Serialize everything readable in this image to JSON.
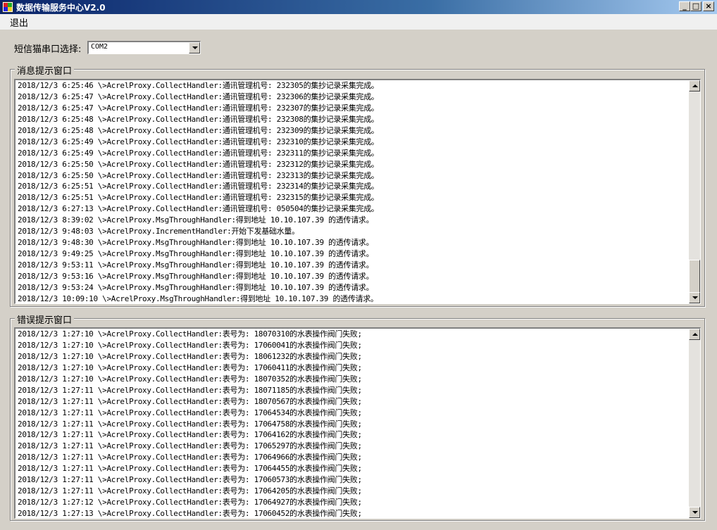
{
  "window": {
    "title": "数据传输服务中心V2.0",
    "buttons": {
      "minimize": "_",
      "maximize": "□",
      "close": "×"
    }
  },
  "menu": {
    "exit_label": "退出"
  },
  "com_select": {
    "label": "短信猫串口选择:",
    "value": "COM2"
  },
  "message_panel": {
    "title": "消息提示窗口",
    "lines": [
      "2018/12/3 6:25:46 \\>AcrelProxy.CollectHandler:通讯管理机号: 232305的集抄记录采集完成。",
      "2018/12/3 6:25:47 \\>AcrelProxy.CollectHandler:通讯管理机号: 232306的集抄记录采集完成。",
      "2018/12/3 6:25:47 \\>AcrelProxy.CollectHandler:通讯管理机号: 232307的集抄记录采集完成。",
      "2018/12/3 6:25:48 \\>AcrelProxy.CollectHandler:通讯管理机号: 232308的集抄记录采集完成。",
      "2018/12/3 6:25:48 \\>AcrelProxy.CollectHandler:通讯管理机号: 232309的集抄记录采集完成。",
      "2018/12/3 6:25:49 \\>AcrelProxy.CollectHandler:通讯管理机号: 232310的集抄记录采集完成。",
      "2018/12/3 6:25:49 \\>AcrelProxy.CollectHandler:通讯管理机号: 232311的集抄记录采集完成。",
      "2018/12/3 6:25:50 \\>AcrelProxy.CollectHandler:通讯管理机号: 232312的集抄记录采集完成。",
      "2018/12/3 6:25:50 \\>AcrelProxy.CollectHandler:通讯管理机号: 232313的集抄记录采集完成。",
      "2018/12/3 6:25:51 \\>AcrelProxy.CollectHandler:通讯管理机号: 232314的集抄记录采集完成。",
      "2018/12/3 6:25:51 \\>AcrelProxy.CollectHandler:通讯管理机号: 232315的集抄记录采集完成。",
      "2018/12/3 6:27:13 \\>AcrelProxy.CollectHandler:通讯管理机号: 050504的集抄记录采集完成。",
      "2018/12/3 8:39:02 \\>AcrelProxy.MsgThroughHandler:得到地址 10.10.107.39 的透传请求。",
      "2018/12/3 9:48:03 \\>AcrelProxy.IncrementHandler:开始下发基础水量。",
      "2018/12/3 9:48:30 \\>AcrelProxy.MsgThroughHandler:得到地址 10.10.107.39 的透传请求。",
      "2018/12/3 9:49:25 \\>AcrelProxy.MsgThroughHandler:得到地址 10.10.107.39 的透传请求。",
      "2018/12/3 9:53:11 \\>AcrelProxy.MsgThroughHandler:得到地址 10.10.107.39 的透传请求。",
      "2018/12/3 9:53:16 \\>AcrelProxy.MsgThroughHandler:得到地址 10.10.107.39 的透传请求。",
      "2018/12/3 9:53:24 \\>AcrelProxy.MsgThroughHandler:得到地址 10.10.107.39 的透传请求。",
      "2018/12/3 10:09:10 \\>AcrelProxy.MsgThroughHandler:得到地址 10.10.107.39 的透传请求。"
    ]
  },
  "error_panel": {
    "title": "错误提示窗口",
    "lines": [
      "2018/12/3 1:27:10 \\>AcrelProxy.CollectHandler:表号为: 18070310的水表操作阀门失败;",
      "2018/12/3 1:27:10 \\>AcrelProxy.CollectHandler:表号为: 17060041的水表操作阀门失败;",
      "2018/12/3 1:27:10 \\>AcrelProxy.CollectHandler:表号为: 18061232的水表操作阀门失败;",
      "2018/12/3 1:27:10 \\>AcrelProxy.CollectHandler:表号为: 17060411的水表操作阀门失败;",
      "2018/12/3 1:27:10 \\>AcrelProxy.CollectHandler:表号为: 18070352的水表操作阀门失败;",
      "2018/12/3 1:27:11 \\>AcrelProxy.CollectHandler:表号为: 18071185的水表操作阀门失败;",
      "2018/12/3 1:27:11 \\>AcrelProxy.CollectHandler:表号为: 18070567的水表操作阀门失败;",
      "2018/12/3 1:27:11 \\>AcrelProxy.CollectHandler:表号为: 17064534的水表操作阀门失败;",
      "2018/12/3 1:27:11 \\>AcrelProxy.CollectHandler:表号为: 17064758的水表操作阀门失败;",
      "2018/12/3 1:27:11 \\>AcrelProxy.CollectHandler:表号为: 17064162的水表操作阀门失败;",
      "2018/12/3 1:27:11 \\>AcrelProxy.CollectHandler:表号为: 17065297的水表操作阀门失败;",
      "2018/12/3 1:27:11 \\>AcrelProxy.CollectHandler:表号为: 17064966的水表操作阀门失败;",
      "2018/12/3 1:27:11 \\>AcrelProxy.CollectHandler:表号为: 17064455的水表操作阀门失败;",
      "2018/12/3 1:27:11 \\>AcrelProxy.CollectHandler:表号为: 17060573的水表操作阀门失败;",
      "2018/12/3 1:27:11 \\>AcrelProxy.CollectHandler:表号为: 17064205的水表操作阀门失败;",
      "2018/12/3 1:27:12 \\>AcrelProxy.CollectHandler:表号为: 17064927的水表操作阀门失败;",
      "2018/12/3 1:27:13 \\>AcrelProxy.CollectHandler:表号为: 17060452的水表操作阀门失败;"
    ]
  }
}
